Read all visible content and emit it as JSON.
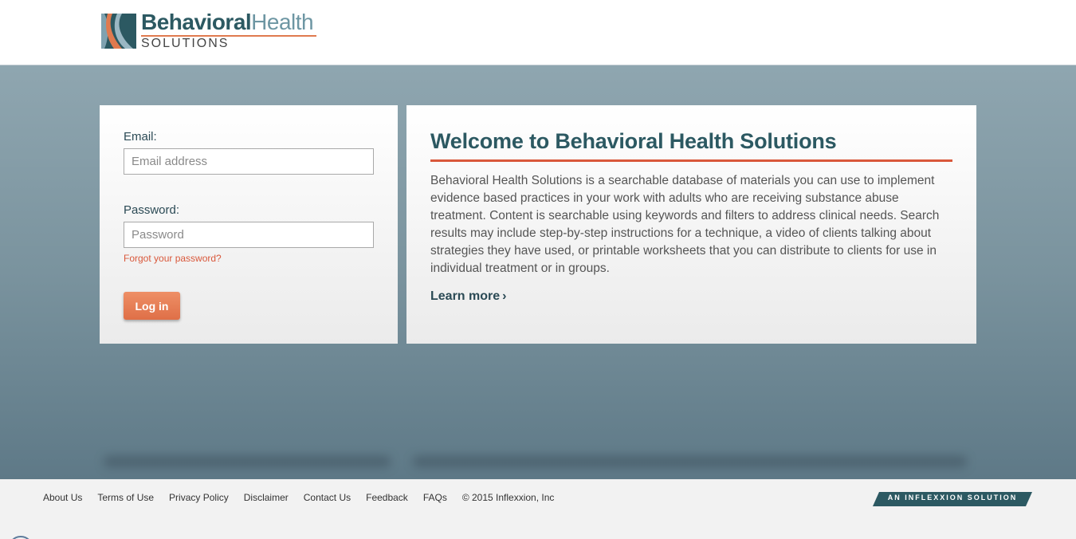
{
  "colors": {
    "brand_teal": "#2c5962",
    "brand_light": "#6d96a3",
    "accent_orange": "#d9583b",
    "button_orange": "#e57b53"
  },
  "header": {
    "logo_word1": "Behavioral",
    "logo_word2": "Health",
    "logo_sub": "SOLUTIONS"
  },
  "login": {
    "email_label": "Email:",
    "email_placeholder": "Email address",
    "email_value": "",
    "password_label": "Password:",
    "password_placeholder": "Password",
    "password_value": "",
    "forgot_link": "Forgot your password?",
    "login_button": "Log in"
  },
  "welcome": {
    "title": "Welcome to Behavioral Health Solutions",
    "body": "Behavioral Health Solutions is a searchable database of materials you can use to implement evidence based practices in your work with adults who are receiving substance abuse treatment. Content is searchable using keywords and filters to address clinical needs. Search results may include step-by-step instructions for a technique, a video of clients talking about strategies they have used, or printable worksheets that you can distribute to clients for use in individual treatment or in groups.",
    "learn_more": "Learn more",
    "learn_more_icon": "chevron-right-icon"
  },
  "footer": {
    "links": [
      "About Us",
      "Terms of Use",
      "Privacy Policy",
      "Disclaimer",
      "Contact Us",
      "Feedback",
      "FAQs"
    ],
    "copyright": "© 2015 Inflexxion, Inc",
    "partner_badge": "AN INFLEXXION SOLUTION"
  }
}
